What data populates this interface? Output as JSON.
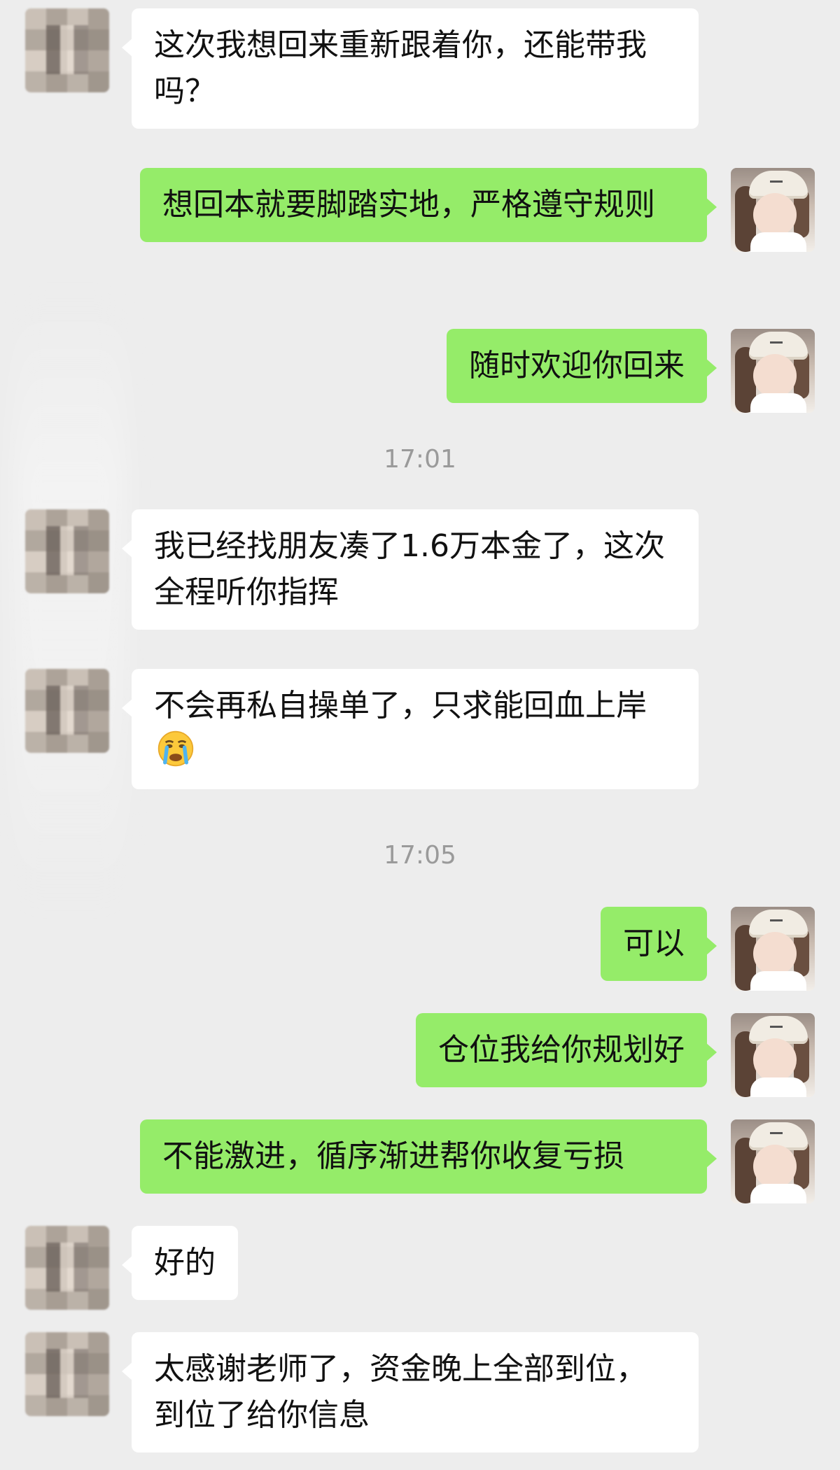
{
  "conversation": [
    {
      "side": "in",
      "text": "这次我想回来重新跟着你，还能带我吗？"
    },
    {
      "side": "out",
      "text": "想回本就要脚踏实地，严格遵守规则"
    },
    {
      "side": "out",
      "text": "随时欢迎你回来"
    },
    {
      "type": "time",
      "text": "17:01"
    },
    {
      "side": "in",
      "text": "我已经找朋友凑了1.6万本金了，这次全程听你指挥"
    },
    {
      "side": "in",
      "text": "不会再私自操单了，只求能回血上岸",
      "emoji": "crying-face-emoji"
    },
    {
      "type": "time",
      "text": "17:05"
    },
    {
      "side": "out",
      "text": "可以"
    },
    {
      "side": "out",
      "text": "仓位我给你规划好"
    },
    {
      "side": "out",
      "text": "不能激进，循序渐进帮你收复亏损"
    },
    {
      "side": "in",
      "text": "好的"
    },
    {
      "side": "in",
      "text": "太感谢老师了，资金晚上全部到位，到位了给你信息"
    }
  ],
  "colors": {
    "background": "#ededed",
    "incoming_bubble": "#ffffff",
    "outgoing_bubble": "#95ec69",
    "timestamp": "#9a9a9a",
    "text": "#111111"
  }
}
